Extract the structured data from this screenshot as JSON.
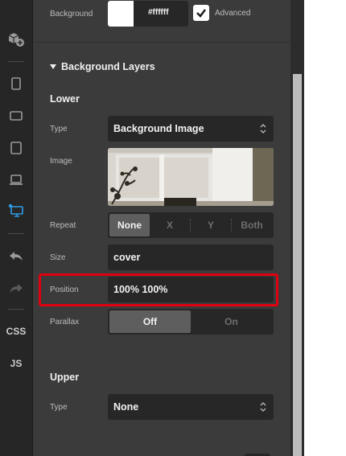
{
  "rail": {
    "items": [
      {
        "name": "add-block-icon"
      },
      {
        "name": "phone-portrait-icon"
      },
      {
        "name": "phone-landscape-icon"
      },
      {
        "name": "tablet-icon"
      },
      {
        "name": "laptop-icon"
      },
      {
        "name": "desktop-icon",
        "active": true
      },
      {
        "name": "undo-icon"
      },
      {
        "name": "redo-icon"
      }
    ],
    "css_label": "CSS",
    "js_label": "JS"
  },
  "background": {
    "label": "Background",
    "color_hex": "#ffffff",
    "advanced_label": "Advanced",
    "advanced_checked": true
  },
  "layers": {
    "title": "Background Layers",
    "lower": {
      "heading": "Lower",
      "type_label": "Type",
      "type_value": "Background Image",
      "image_label": "Image",
      "repeat_label": "Repeat",
      "repeat_options": [
        "None",
        "X",
        "Y",
        "Both"
      ],
      "repeat_selected": "None",
      "size_label": "Size",
      "size_value": "cover",
      "position_label": "Position",
      "position_value": "100% 100%",
      "parallax_label": "Parallax",
      "parallax_options": [
        "Off",
        "On"
      ],
      "parallax_selected": "Off"
    },
    "upper": {
      "heading": "Upper",
      "type_label": "Type",
      "type_value": "None"
    }
  },
  "colors": {
    "panel": "#3b3b3b",
    "rail": "#262626",
    "field": "#272727",
    "accent": "#2e9be6",
    "highlight": "#e00010"
  }
}
